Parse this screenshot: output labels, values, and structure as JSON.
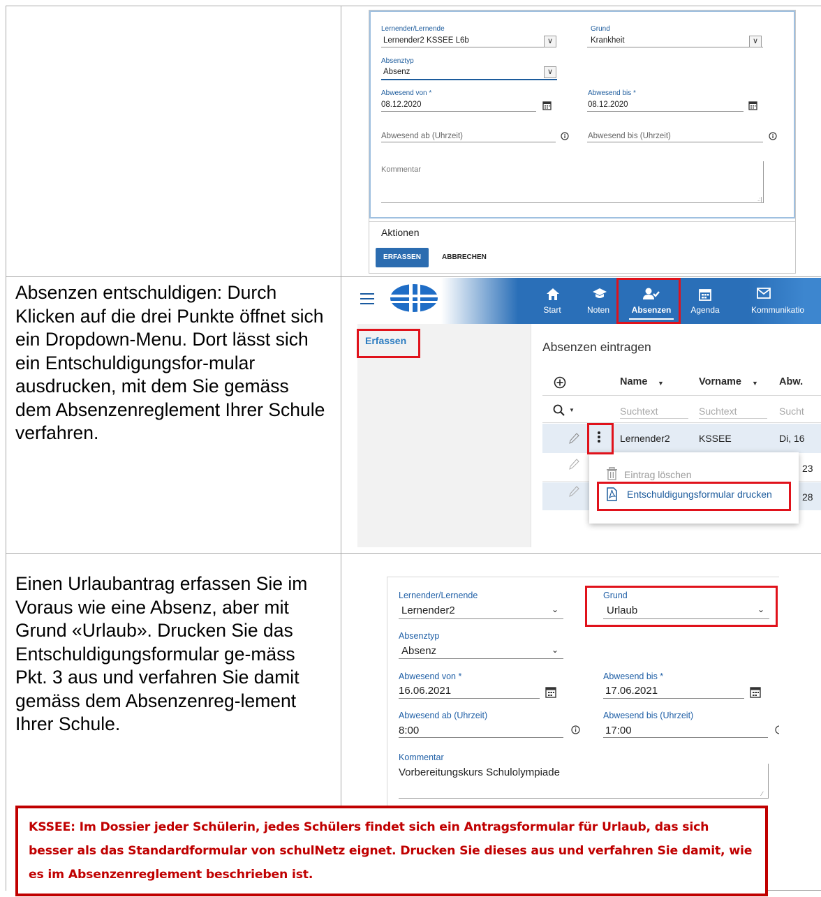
{
  "form1": {
    "learner_label": "Lernender/Lernende",
    "learner_value": "Lernender2 KSSEE L6b",
    "reason_label": "Grund",
    "reason_value": "Krankheit",
    "type_label": "Absenztyp",
    "type_value": "Absenz",
    "from_label": "Abwesend von *",
    "from_value": "08.12.2020",
    "to_label": "Abwesend bis *",
    "to_value": "08.12.2020",
    "from_time_placeholder": "Abwesend ab (Uhrzeit)",
    "to_time_placeholder": "Abwesend bis (Uhrzeit)",
    "comment_placeholder": "Kommentar",
    "actions_title": "Aktionen",
    "submit_label": "ERFASSEN",
    "cancel_label": "ABBRECHEN"
  },
  "instructions": {
    "excuse_text": "Absenzen entschuldigen: Durch Klicken auf die drei Punkte öffnet sich ein Dropdown-Menu. Dort lässt sich ein Entschuldigungsfor-mular ausdrucken, mit dem Sie gemäss dem Absenzenreglement Ihrer Schule verfahren.",
    "vacation_text": "Einen Urlaubantrag erfassen Sie im Voraus wie eine Absenz, aber mit Grund «Urlaub». Drucken Sie das Entschuldigungsformular ge-mäss Pkt. 3 aus und verfahren Sie damit gemäss dem Absenzenreg-lement Ihrer Schule."
  },
  "nav": {
    "items": [
      {
        "label": "Start",
        "icon": "home-icon"
      },
      {
        "label": "Noten",
        "icon": "graduation-cap-icon"
      },
      {
        "label": "Absenzen",
        "icon": "user-check-icon",
        "active": true
      },
      {
        "label": "Agenda",
        "icon": "calendar-icon"
      },
      {
        "label": "Kommunikatio",
        "icon": "mail-icon"
      }
    ],
    "sidebar_link": "Erfassen"
  },
  "absences": {
    "title": "Absenzen eintragen",
    "columns": [
      "Name",
      "Vorname",
      "Abw."
    ],
    "search_placeholders": [
      "Suchtext",
      "Suchtext",
      "Sucht"
    ],
    "rows": [
      {
        "name": "Lernender2",
        "vorname": "KSSEE",
        "abw": "Di, 16"
      },
      {
        "abw": "23"
      },
      {
        "abw": "28"
      }
    ],
    "menu": {
      "delete_label": "Eintrag löschen",
      "print_label": "Entschuldigungsformular drucken"
    }
  },
  "form3": {
    "learner_label": "Lernender/Lernende",
    "learner_value": "Lernender2",
    "reason_label": "Grund",
    "reason_value": "Urlaub",
    "type_label": "Absenztyp",
    "type_value": "Absenz",
    "from_label": "Abwesend von *",
    "from_value": "16.06.2021",
    "to_label": "Abwesend bis *",
    "to_value": "17.06.2021",
    "from_time_label": "Abwesend ab (Uhrzeit)",
    "from_time_value": "8:00",
    "to_time_label": "Abwesend bis (Uhrzeit)",
    "to_time_value": "17:00",
    "comment_label": "Kommentar",
    "comment_value": "Vorbereitungskurs Schulolympiade"
  },
  "notice": {
    "text": "KSSEE: Im Dossier jeder Schülerin, jedes Schülers findet sich ein Antragsformular für Urlaub, das  sich besser als das Standardformular von schulNetz eignet. Drucken Sie dieses aus und verfahren Sie damit, wie es im Absenzenreglement beschrieben ist."
  },
  "colors": {
    "brand_blue": "#2b6cb0",
    "nav_blue": "#2a6fb8",
    "highlight_red": "#e0121b",
    "notice_red": "#c00000"
  }
}
